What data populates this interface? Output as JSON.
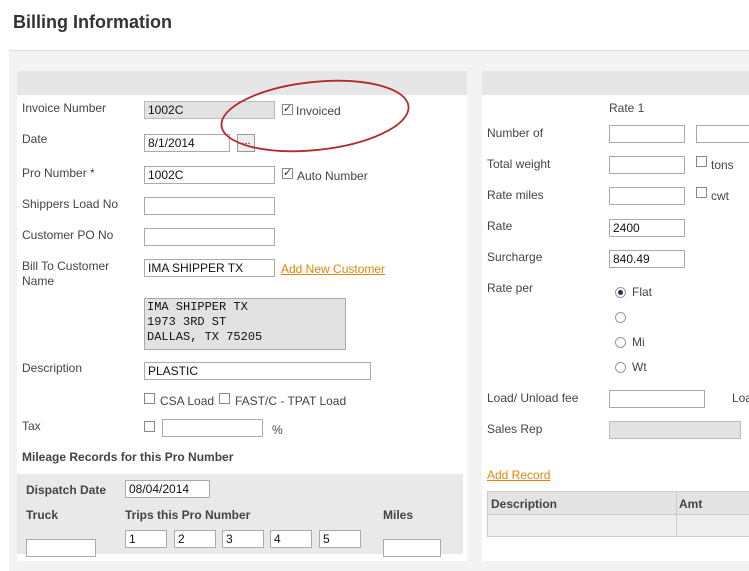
{
  "page": {
    "title": "Billing Information"
  },
  "left": {
    "invoice_number_label": "Invoice Number",
    "invoice_number_value": "1002C",
    "invoiced_label": "Invoiced",
    "date_label": "Date",
    "date_value": "8/1/2014",
    "date_button_label": "...",
    "pro_number_label": "Pro Number *",
    "pro_number_value": "1002C",
    "auto_number_label": "Auto Number",
    "shippers_load_label": "Shippers Load No",
    "customer_po_label": "Customer PO No",
    "bill_to_label_line1": "Bill To Customer",
    "bill_to_label_line2": "Name",
    "bill_to_value": "IMA SHIPPER TX",
    "add_customer_link": "Add New Customer",
    "address_text": "IMA SHIPPER TX\n1973 3RD ST\nDALLAS, TX 75205",
    "description_label": "Description",
    "description_value": "PLASTIC",
    "csa_label": "CSA Load",
    "fast_label": "FAST/C - TPAT Load",
    "tax_label": "Tax",
    "tax_unit": "%",
    "mileage_heading": "Mileage Records for this Pro Number",
    "dispatch_date_label": "Dispatch Date",
    "dispatch_date_value": "08/04/2014",
    "truck_label": "Truck",
    "trips_label": "Trips this Pro Number",
    "miles_label": "Miles",
    "trip_values": [
      "1",
      "2",
      "3",
      "4",
      "5"
    ]
  },
  "right": {
    "rate1_label": "Rate 1",
    "number_of_label": "Number of",
    "total_weight_label": "Total weight",
    "tons_label": "tons",
    "rate_miles_label": "Rate miles",
    "cwt_label": "cwt",
    "rate_label": "Rate",
    "rate_value": "2400",
    "surcharge_label": "Surcharge",
    "surcharge_value": "840.49",
    "rate_per_label": "Rate per",
    "rate_per_options": [
      "Flat",
      "",
      "Mi",
      "Wt"
    ],
    "load_unload_label": "Load/ Unload fee",
    "load_cut_label": "Loa",
    "sales_rep_label": "Sales Rep",
    "add_record_link": "Add Record",
    "table_headers": [
      "Description",
      "Amt"
    ]
  },
  "annotation": {
    "ellipse_color": "#b42a2a"
  }
}
